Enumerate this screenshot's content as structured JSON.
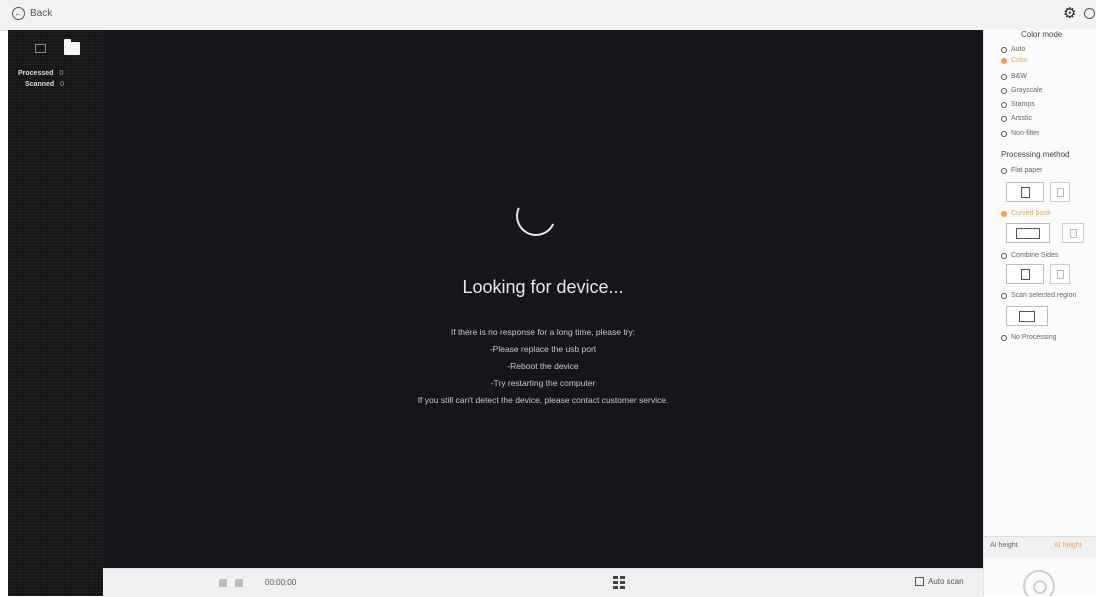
{
  "topbar": {
    "back_label": "Back",
    "gear_icon": "gear-icon",
    "help_icon": "help-icon"
  },
  "left_panel": {
    "icons": [
      "scan-view-icon",
      "folder-icon"
    ],
    "processed_label": "Processed",
    "processed_count": "0",
    "scanned_label": "Scanned",
    "scanned_count": "0"
  },
  "main": {
    "status": "Looking for device...",
    "hints": [
      "If there is no response for a long time, please try:",
      "-Please replace the usb port",
      "-Reboot the device",
      "-Try restarting the computer",
      "If you still can't detect the device, please contact customer service."
    ]
  },
  "bottombar": {
    "time": "00:00:00",
    "auto_scan_label": "Auto scan"
  },
  "right_panel": {
    "color_mode_title": "Color mode",
    "color_modes": [
      "Auto",
      "Color",
      "B&W",
      "Grayscale",
      "Stamps",
      "Artistic",
      "Non-filter"
    ],
    "color_mode_selected": "Color",
    "processing_title": "Processing method",
    "processing_options": [
      "Flat paper",
      "Curved book",
      "Combine Sides",
      "Scan selected region",
      "No Processing"
    ],
    "processing_selected": "Curved book",
    "tabs": [
      "AI height",
      "AI height"
    ],
    "accent_color": "#f0a24a"
  }
}
